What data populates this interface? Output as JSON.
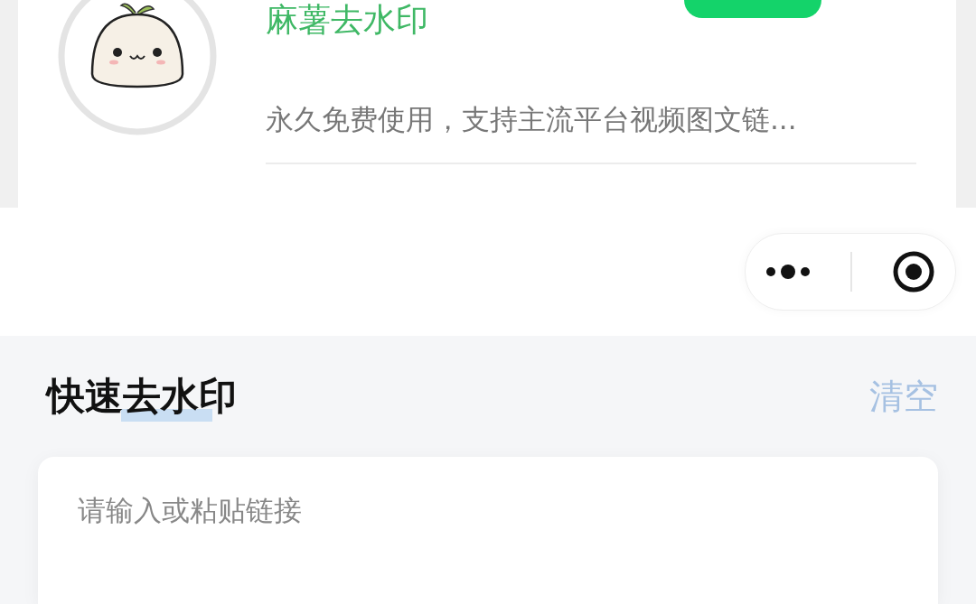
{
  "app_card": {
    "title": "麻薯去水印",
    "description": "永久免费使用，支持主流平台视频图文链..."
  },
  "section": {
    "title": "快速去水印",
    "clear_label": "清空"
  },
  "link_input": {
    "placeholder": "请输入或粘贴链接"
  }
}
